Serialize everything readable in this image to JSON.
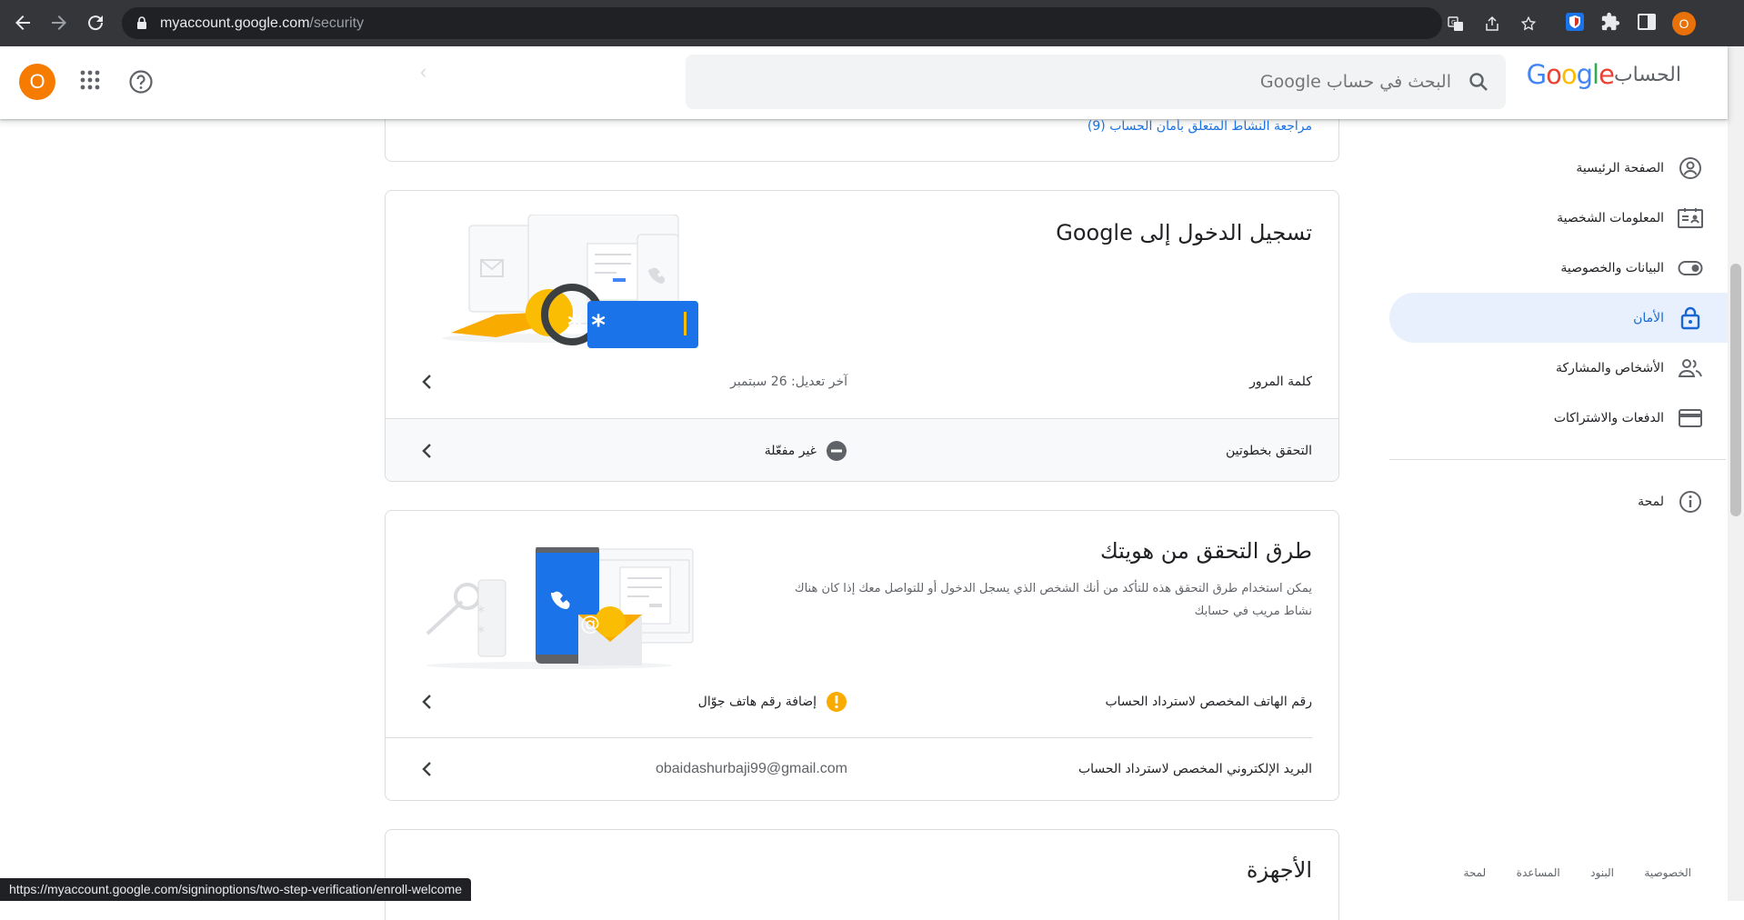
{
  "browser": {
    "url_host": "myaccount.google.com",
    "url_path": "/security",
    "profile_initial": "O",
    "status_url": "https://myaccount.google.com/signinoptions/two-step-verification/enroll-welcome"
  },
  "header": {
    "brand_product": "الحساب",
    "search_placeholder": "البحث في حساب Google",
    "avatar_initial": "O"
  },
  "sidebar": {
    "items": [
      {
        "label": "الصفحة الرئيسية",
        "icon": "home-icon"
      },
      {
        "label": "المعلومات الشخصية",
        "icon": "id-card-icon"
      },
      {
        "label": "البيانات والخصوصية",
        "icon": "toggle-icon"
      },
      {
        "label": "الأمان",
        "icon": "lock-icon",
        "active": true
      },
      {
        "label": "الأشخاص والمشاركة",
        "icon": "people-icon"
      },
      {
        "label": "الدفعات والاشتراكات",
        "icon": "card-icon"
      }
    ],
    "about": {
      "label": "لمحة",
      "icon": "info-icon"
    },
    "footer": [
      "الخصوصية",
      "البنود",
      "المساعدة",
      "لمحة"
    ]
  },
  "security_activity": {
    "link": "مراجعة النشاط المتعلق بأمان الحساب (9)"
  },
  "signin_card": {
    "title": "تسجيل الدخول إلى Google",
    "rows": [
      {
        "label": "كلمة المرور",
        "value": "آخر تعديل: 26 سبتمبر"
      },
      {
        "label": "التحقق بخطوتين",
        "value": "غير مفعّلة"
      }
    ]
  },
  "verify_card": {
    "title": "طرق التحقق من هويتك",
    "description": "يمكن استخدام طرق التحقق هذه للتأكد من أنك الشخص الذي يسجل الدخول أو للتواصل معك إذا كان هناك نشاط مريب في حسابك",
    "rows": [
      {
        "label": "رقم الهاتف المخصص لاسترداد الحساب",
        "value": "إضافة رقم هاتف جوّال"
      },
      {
        "label": "البريد الإلكتروني المخصص لاسترداد الحساب",
        "value": "obaidashurbaji99@gmail.com"
      }
    ]
  },
  "devices_card": {
    "title": "الأجهزة"
  },
  "colors": {
    "accent": "#1a73e8",
    "active_bg": "#e8f0fe",
    "warning": "#f9ab00",
    "avatar": "#f57c00"
  }
}
